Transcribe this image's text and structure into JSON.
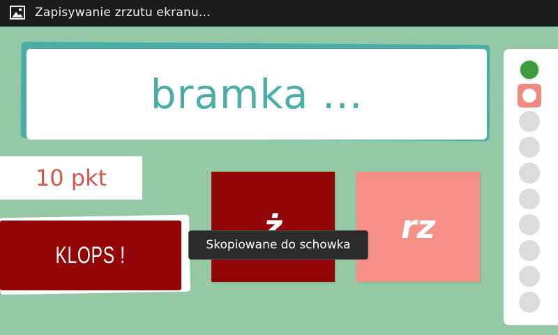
{
  "status_bar": {
    "icon": "image-icon",
    "text": "Zapisywanie zrzutu ekranu..."
  },
  "question": {
    "word": "bramka ..."
  },
  "score": {
    "text": "10 pkt"
  },
  "klops_button": {
    "label": "KLOPS !"
  },
  "answers": [
    {
      "label": "ż"
    },
    {
      "label": "rz"
    }
  ],
  "toast": {
    "text": "Skopiowane do schowka"
  },
  "progress": {
    "total": 10,
    "states": [
      "correct",
      "current",
      "pending",
      "pending",
      "pending",
      "pending",
      "pending",
      "pending",
      "pending",
      "pending"
    ]
  },
  "colors": {
    "background": "#95c9a5",
    "accent_teal": "#4aaea7",
    "dark_red": "#930607",
    "salmon": "#f79188",
    "score_red": "#d6544d",
    "correct_green": "#3c9b3c"
  }
}
